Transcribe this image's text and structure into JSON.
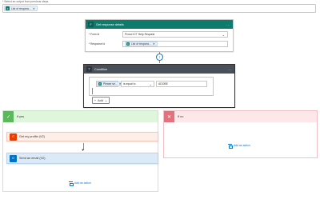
{
  "top": {
    "label": "* Select an output from previous steps",
    "token": "List of respons...",
    "token_icon": "forms-icon"
  },
  "get_response": {
    "title": "Get response details",
    "form_id_label": "* Form Id",
    "form_id_value": "Prosci ICT Help Request",
    "response_id_label": "* Response Id",
    "response_id_token": "List of respons...",
    "header_color": "#0f7b6c"
  },
  "condition": {
    "title": "Condition",
    "left_token": "Please se...",
    "operator": "is equal to",
    "value": "ADOBE",
    "add_label": "Add",
    "header_color": "#484f58"
  },
  "if_yes": {
    "title": "If yes",
    "header_color": "#dff6dd",
    "steps": [
      {
        "title": "Get my profile (V2)",
        "color": "#eb3c00"
      },
      {
        "title": "Send an email (V2)",
        "color": "#0072c6"
      }
    ],
    "add_action": "Add an action"
  },
  "if_no": {
    "title": "If no",
    "header_color": "#fde7e9",
    "add_action": "Add an action"
  },
  "dots": "..."
}
